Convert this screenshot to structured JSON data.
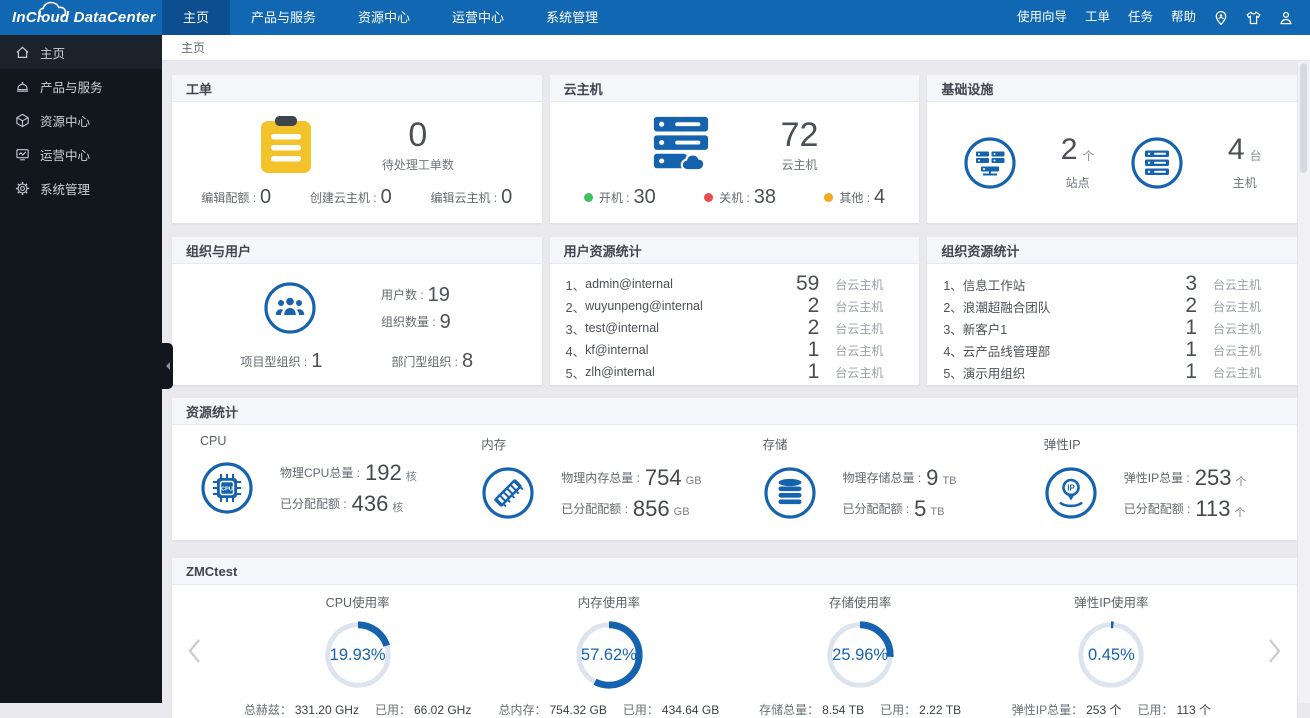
{
  "brand": {
    "logo_text": "InCloud DataCenter"
  },
  "topnav": {
    "items": [
      "主页",
      "产品与服务",
      "资源中心",
      "运营中心",
      "系统管理"
    ],
    "right_links": [
      "使用向导",
      "工单",
      "任务",
      "帮助"
    ]
  },
  "sidebar": {
    "items": [
      "主页",
      "产品与服务",
      "资源中心",
      "运营中心",
      "系统管理"
    ]
  },
  "breadcrumb": {
    "current": "主页"
  },
  "cards": {
    "workorder": {
      "title": "工单",
      "big_value": "0",
      "big_label": "待处理工单数",
      "stats": [
        {
          "label": "编辑配额 :",
          "value": "0"
        },
        {
          "label": "创建云主机 :",
          "value": "0"
        },
        {
          "label": "编辑云主机 :",
          "value": "0"
        }
      ]
    },
    "cloudhost": {
      "title": "云主机",
      "big_value": "72",
      "big_label": "云主机",
      "stats": [
        {
          "label": "开机 :",
          "value": "30",
          "color": "#3FBF62"
        },
        {
          "label": "关机 :",
          "value": "38",
          "color": "#EA4B4C"
        },
        {
          "label": "其他 :",
          "value": "4",
          "color": "#F2A71F"
        }
      ]
    },
    "infrastructure": {
      "title": "基础设施",
      "items": [
        {
          "value": "2",
          "unit": "个",
          "label": "站点"
        },
        {
          "value": "4",
          "unit": "台",
          "label": "主机"
        }
      ]
    },
    "org_users": {
      "title": "组织与用户",
      "top_stats": [
        {
          "label": "用户数 :",
          "value": "19"
        },
        {
          "label": "组织数量 :",
          "value": "9"
        }
      ],
      "bottom_stats": [
        {
          "label": "项目型组织 :",
          "value": "1"
        },
        {
          "label": "部门型组织 :",
          "value": "8"
        }
      ]
    },
    "user_resources": {
      "title": "用户资源统计",
      "unit": "台云主机",
      "rows": [
        {
          "rank": "1、",
          "name": "admin@internal",
          "value": "59"
        },
        {
          "rank": "2、",
          "name": "wuyunpeng@internal",
          "value": "2"
        },
        {
          "rank": "3、",
          "name": "test@internal",
          "value": "2"
        },
        {
          "rank": "4、",
          "name": "kf@internal",
          "value": "1"
        },
        {
          "rank": "5、",
          "name": "zlh@internal",
          "value": "1"
        }
      ]
    },
    "org_resources": {
      "title": "组织资源统计",
      "unit": "台云主机",
      "rows": [
        {
          "rank": "1、",
          "name": "信息工作站",
          "value": "3"
        },
        {
          "rank": "2、",
          "name": "浪潮超融合团队",
          "value": "2"
        },
        {
          "rank": "3、",
          "name": "新客户1",
          "value": "1"
        },
        {
          "rank": "4、",
          "name": "云产品线管理部",
          "value": "1"
        },
        {
          "rank": "5、",
          "name": "演示用组织",
          "value": "1"
        }
      ]
    },
    "resources": {
      "title": "资源统计",
      "items": [
        {
          "label": "CPU",
          "total_label": "物理CPU总量 :",
          "total_value": "192",
          "total_unit": "核",
          "quota_label": "已分配配额 :",
          "quota_value": "436",
          "quota_unit": "核"
        },
        {
          "label": "内存",
          "total_label": "物理内存总量 :",
          "total_value": "754",
          "total_unit": "GB",
          "quota_label": "已分配配额 :",
          "quota_value": "856",
          "quota_unit": "GB"
        },
        {
          "label": "存储",
          "total_label": "物理存储总量 :",
          "total_value": "9",
          "total_unit": "TB",
          "quota_label": "已分配配额 :",
          "quota_value": "5",
          "quota_unit": "TB"
        },
        {
          "label": "弹性IP",
          "total_label": "弹性IP总量 :",
          "total_value": "253",
          "total_unit": "个",
          "quota_label": "已分配配额 :",
          "quota_value": "113",
          "quota_unit": "个"
        }
      ]
    },
    "zmctest": {
      "title": "ZMCtest",
      "gauges": [
        {
          "title": "CPU使用率",
          "percent": 19.93,
          "percent_text": "19.93%",
          "total_label": "总赫兹：",
          "total_value": "331.20 GHz",
          "used_label": "已用：",
          "used_value": "66.02 GHz"
        },
        {
          "title": "内存使用率",
          "percent": 57.62,
          "percent_text": "57.62%",
          "total_label": "总内存：",
          "total_value": "754.32 GB",
          "used_label": "已用：",
          "used_value": "434.64 GB"
        },
        {
          "title": "存储使用率",
          "percent": 25.96,
          "percent_text": "25.96%",
          "total_label": "存储总量：",
          "total_value": "8.54 TB",
          "used_label": "已用：",
          "used_value": "2.22 TB"
        },
        {
          "title": "弹性IP使用率",
          "percent": 0.45,
          "percent_text": "0.45%",
          "total_label": "弹性IP总量：",
          "total_value": "253 个",
          "used_label": "已用：",
          "used_value": "113 个"
        }
      ]
    }
  },
  "colors": {
    "navbar": "#1167B1",
    "navbar_active": "#0D4E91",
    "sidebar": "#12171E",
    "accent_blue": "#1563AE",
    "gauge_track": "#DDE3EF",
    "status_on": "#3FBF62",
    "status_off": "#EA4B4C",
    "status_other": "#F2A71F",
    "clipboard_yellow": "#F4C22B",
    "page_bg": "#E9E9EE"
  }
}
